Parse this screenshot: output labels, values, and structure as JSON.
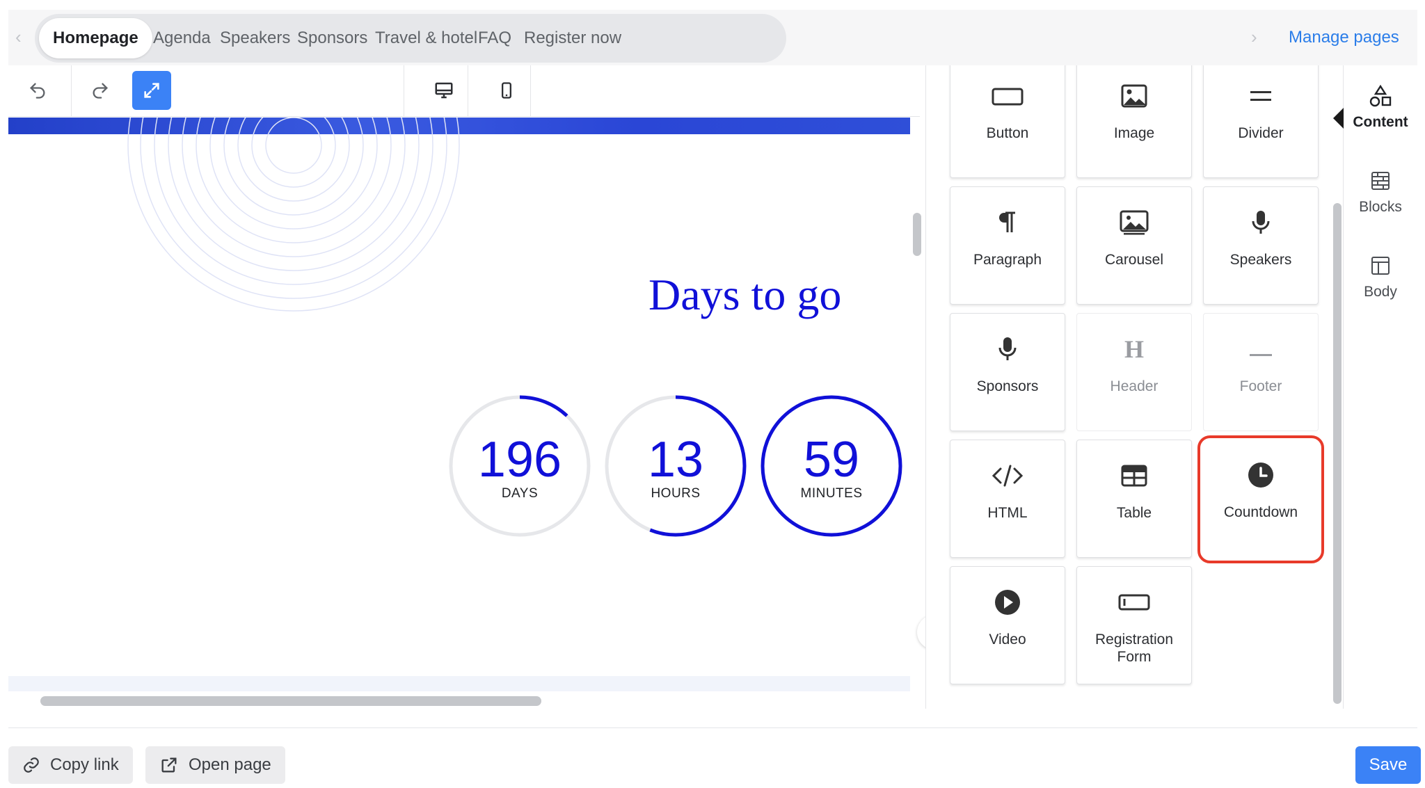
{
  "nav": {
    "tabs": [
      {
        "label": "Homepage",
        "active": true
      },
      {
        "label": "Agenda"
      },
      {
        "label": "Speakers"
      },
      {
        "label": "Sponsors"
      },
      {
        "label": "Travel & hotel"
      },
      {
        "label": "FAQ"
      },
      {
        "label": "Register now"
      }
    ],
    "manage_pages": "Manage pages"
  },
  "toolbar": {
    "undo_icon": "undo-icon",
    "redo_icon": "redo-icon",
    "expand_icon": "expand-icon",
    "desktop_icon": "desktop-icon",
    "mobile_icon": "mobile-icon"
  },
  "canvas": {
    "title": "Days to go",
    "countdown": [
      {
        "value": "196",
        "label": "DAYS",
        "fraction": 0.12
      },
      {
        "value": "13",
        "label": "HOURS",
        "fraction": 0.56
      },
      {
        "value": "59",
        "label": "MINUTES",
        "fraction": 1.0
      }
    ],
    "accent_color": "#1010d8"
  },
  "panel": {
    "tiles": [
      {
        "label": "Button",
        "icon": "button-icon"
      },
      {
        "label": "Image",
        "icon": "image-icon"
      },
      {
        "label": "Divider",
        "icon": "divider-icon"
      },
      {
        "label": "Paragraph",
        "icon": "paragraph-icon"
      },
      {
        "label": "Carousel",
        "icon": "carousel-icon"
      },
      {
        "label": "Speakers",
        "icon": "microphone-icon"
      },
      {
        "label": "Sponsors",
        "icon": "microphone-icon"
      },
      {
        "label": "Header",
        "icon": "header-icon",
        "disabled": true
      },
      {
        "label": "Footer",
        "icon": "footer-icon",
        "disabled": true
      },
      {
        "label": "HTML",
        "icon": "code-icon"
      },
      {
        "label": "Table",
        "icon": "table-icon"
      },
      {
        "label": "Countdown",
        "icon": "clock-icon",
        "selected": true
      },
      {
        "label": "Video",
        "icon": "play-icon"
      },
      {
        "label": "Registration Form",
        "icon": "form-icon"
      }
    ]
  },
  "rail": {
    "items": [
      {
        "label": "Content",
        "icon": "shapes-icon",
        "active": true
      },
      {
        "label": "Blocks",
        "icon": "blocks-icon"
      },
      {
        "label": "Body",
        "icon": "layout-icon"
      }
    ]
  },
  "footer": {
    "copy_link": "Copy link",
    "open_page": "Open page",
    "save": "Save"
  },
  "colors": {
    "primary": "#3b82f6",
    "highlight": "#e83a2a",
    "link": "#2b7de9"
  }
}
